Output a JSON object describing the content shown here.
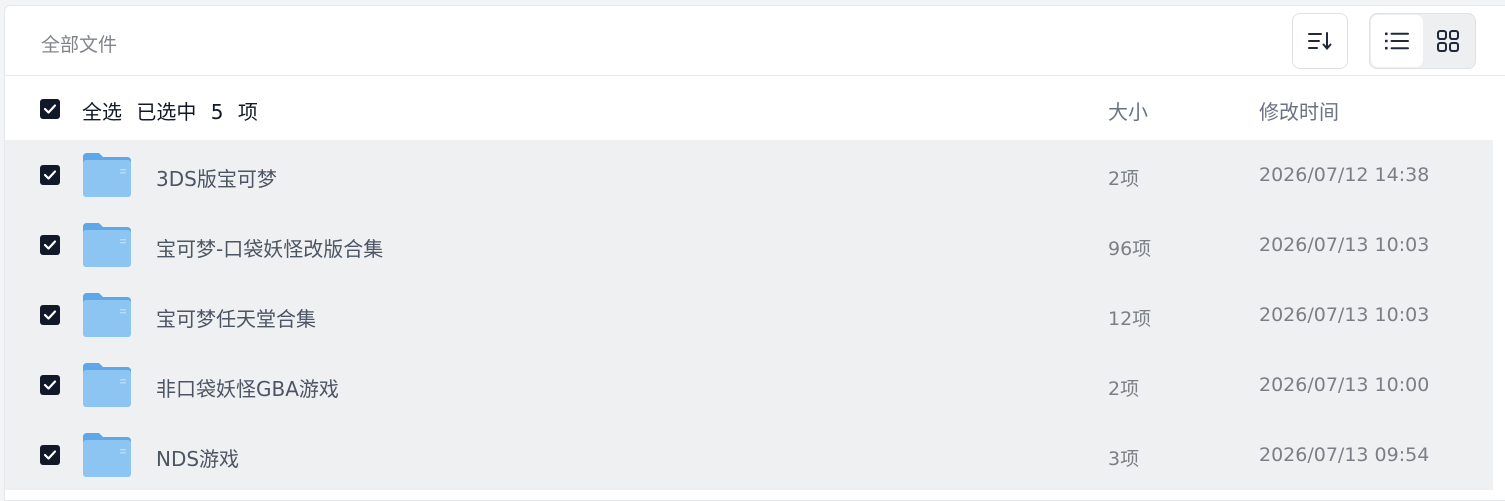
{
  "breadcrumb": {
    "label": "全部文件"
  },
  "toolbar": {
    "sort_icon": "sort-icon",
    "list_view_icon": "list-icon",
    "grid_view_icon": "grid-icon",
    "active_view": "list"
  },
  "header": {
    "select_all": "全选",
    "selected_prefix": "已选中",
    "selected_count": "5",
    "selected_suffix": "项",
    "col_size": "大小",
    "col_modified": "修改时间",
    "checked": true
  },
  "files": [
    {
      "name": "3DS版宝可梦",
      "size": "2项",
      "modified": "2026/07/12 14:38",
      "checked": true
    },
    {
      "name": "宝可梦-口袋妖怪改版合集",
      "size": "96项",
      "modified": "2026/07/13 10:03",
      "checked": true
    },
    {
      "name": "宝可梦任天堂合集",
      "size": "12项",
      "modified": "2026/07/13 10:03",
      "checked": true
    },
    {
      "name": "非口袋妖怪GBA游戏",
      "size": "2项",
      "modified": "2026/07/13 10:00",
      "checked": true
    },
    {
      "name": "NDS游戏",
      "size": "3项",
      "modified": "2026/07/13 09:54",
      "checked": true
    }
  ],
  "colors": {
    "selected_row_bg": "#eff0f2",
    "checkbox": "#111827",
    "folder_blue": "#7fbcef"
  }
}
